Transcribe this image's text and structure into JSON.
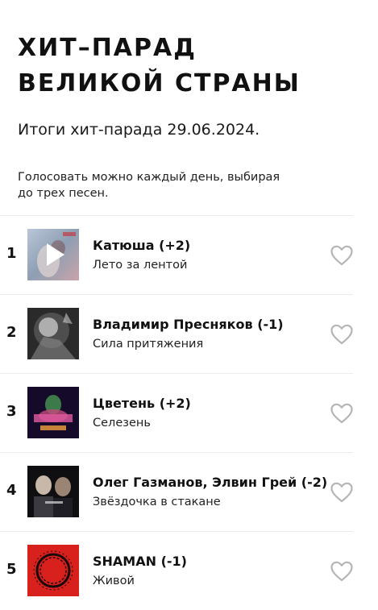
{
  "header": {
    "title_line1": "ХИТ–ПАРАД",
    "title_line2": "ВЕЛИКОЙ СТРАНЫ",
    "subtitle": "Итоги хит-парада 29.06.2024.",
    "note_line1": "Голосовать можно каждый день, выбирая",
    "note_line2": "до трех песен."
  },
  "tracks": [
    {
      "rank": "1",
      "title": "Катюша (+2)",
      "subtitle": "Лето за лентой",
      "cover_icon": "play-icon"
    },
    {
      "rank": "2",
      "title": "Владимир Пресняков (-1)",
      "subtitle": "Сила притяжения"
    },
    {
      "rank": "3",
      "title": "Цветень (+2)",
      "subtitle": "Селезень"
    },
    {
      "rank": "4",
      "title": "Олег Газманов, Элвин Грей (-2)",
      "subtitle": "Звёздочка в стакане"
    },
    {
      "rank": "5",
      "title": "SHAMAN (-1)",
      "subtitle": "Живой"
    }
  ],
  "colors": {
    "heart_stroke": "#b5b5b5",
    "divider": "#ececec"
  }
}
